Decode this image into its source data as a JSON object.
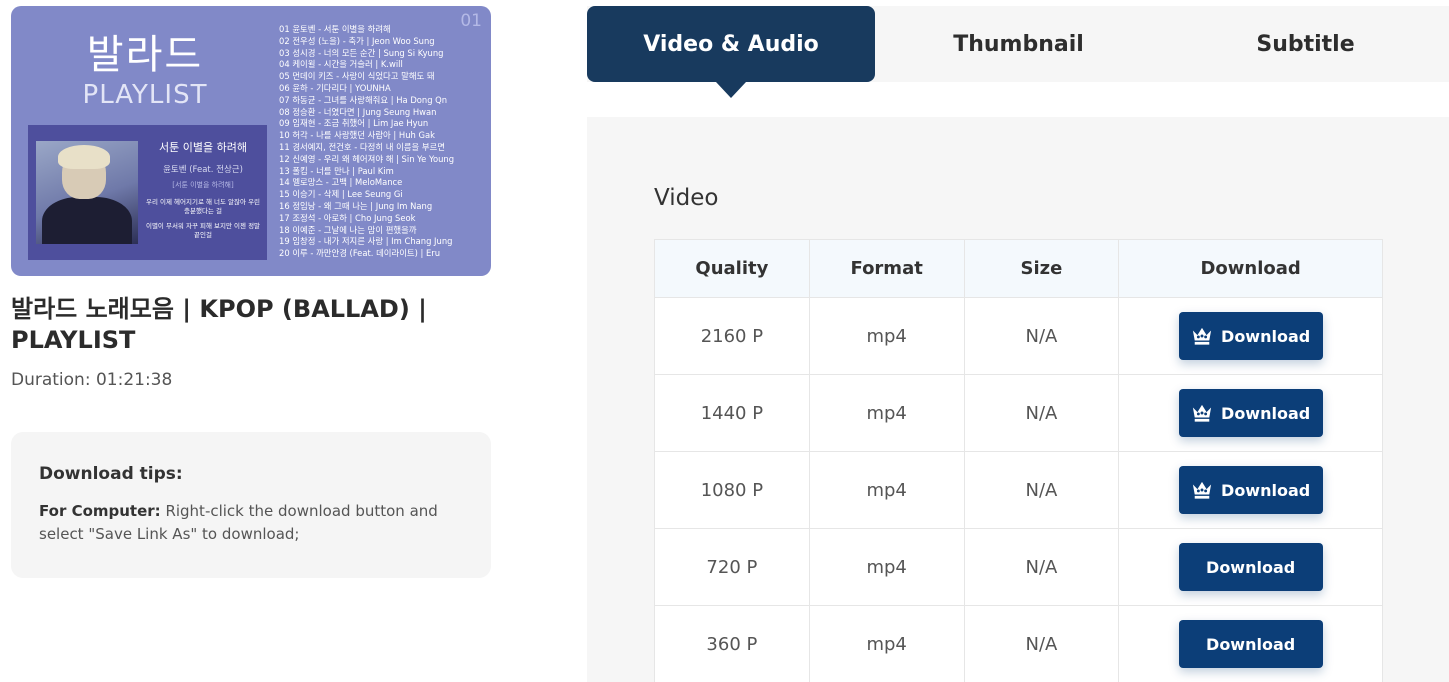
{
  "thumbnail": {
    "big_title": "발라드",
    "sub_title": "PLAYLIST",
    "number_badge": "01",
    "card": {
      "song": "서툰 이별을 하려해",
      "artist": "윤토벤 (Feat. 전상근)",
      "tag": "[서툰 이별을 하려해]",
      "lyric1": "우리 이제 헤어지기로 해 너도 알잖아 우린 충분했다는 걸",
      "lyric2": "이별이 무서워 자꾸 피해 보지만 이젠 정말 끝인걸"
    },
    "tracks": [
      "01 윤토벤 - 서툰 이별을 하려해",
      "02 전우성 (노을) - 축가 | Jeon Woo Sung",
      "03 성시경 - 너의 모든 순간 | Sung Si Kyung",
      "04 케이윌 - 시간을 거슬러 | K.will",
      "05 먼데이 키즈 - 사랑이 식었다고 말해도 돼",
      "06 윤하 - 기다리다 | YOUNHA",
      "07 하동균 - 그녀를 사랑해줘요 | Ha Dong Qn",
      "08 정승환 - 너였다면 | Jung Seung Hwan",
      "09 임재현 - 조금 취했어 | Lim Jae Hyun",
      "10 허각 - 나를 사랑했던 사람아 | Huh Gak",
      "11 경서예지, 전건호 - 다정히 내 이름을 부르면",
      "12 신예영 - 우리 왜 헤어져야 해 | Sin Ye Young",
      "13 폴킴 - 너를 만나 | Paul Kim",
      "14 멜로망스 - 고백 | MeloMance",
      "15 이승기 - 삭제 | Lee Seung Gi",
      "16 정임낭 - 왜 그때 나는 | Jung Im Nang",
      "17 조정석 - 아로하 | Cho Jung Seok",
      "18 이예준 - 그날에 나는 맘이 편했을까",
      "19 임창정 - 내가 저지른 사랑 | Im Chang Jung",
      "20 이루 - 까만안경 (Feat. 데이라이트) | Eru"
    ]
  },
  "video": {
    "title": "발라드 노래모음 | KPOP (BALLAD) | PLAYLIST",
    "duration": "Duration: 01:21:38"
  },
  "tips": {
    "title": "Download tips:",
    "computer_label": "For Computer:",
    "computer_text": " Right-click the download button and select \"Save Link As\" to download;"
  },
  "tabs": [
    {
      "label": "Video & Audio",
      "active": true
    },
    {
      "label": "Thumbnail",
      "active": false
    },
    {
      "label": "Subtitle",
      "active": false
    }
  ],
  "section": {
    "title": "Video",
    "columns": [
      "Quality",
      "Format",
      "Size",
      "Download"
    ],
    "rows": [
      {
        "quality": "2160 P",
        "format": "mp4",
        "size": "N/A",
        "button": "Download",
        "premium": true
      },
      {
        "quality": "1440 P",
        "format": "mp4",
        "size": "N/A",
        "button": "Download",
        "premium": true
      },
      {
        "quality": "1080 P",
        "format": "mp4",
        "size": "N/A",
        "button": "Download",
        "premium": true
      },
      {
        "quality": "720 P",
        "format": "mp4",
        "size": "N/A",
        "button": "Download",
        "premium": false
      },
      {
        "quality": "360 P",
        "format": "mp4",
        "size": "N/A",
        "button": "Download",
        "premium": false
      }
    ]
  },
  "colors": {
    "accent": "#183a5e",
    "button": "#0c3e78",
    "thumb_bg": "#8189c8"
  },
  "icons": {
    "premium": "crown-icon"
  }
}
